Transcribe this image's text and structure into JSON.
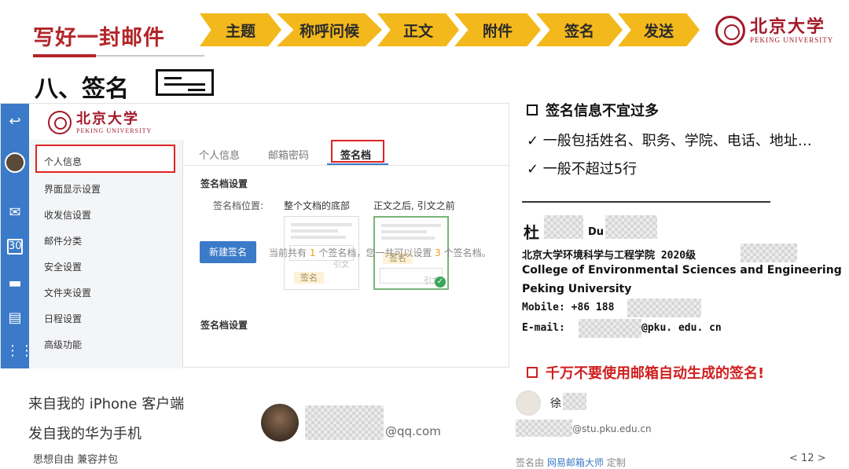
{
  "header": {
    "title": "写好一封邮件",
    "steps": [
      "主题",
      "称呼问候",
      "正文",
      "附件",
      "签名",
      "发送"
    ],
    "logo": {
      "cn": "北京大学",
      "en": "PEKING UNIVERSITY"
    }
  },
  "section": {
    "title": "八、签名"
  },
  "mail_client": {
    "logo": {
      "cn": "北京大学",
      "en": "PEKING UNIVERSITY"
    },
    "sidebar": [
      "个人信息",
      "界面显示设置",
      "收发信设置",
      "邮件分类",
      "安全设置",
      "文件夹设置",
      "日程设置",
      "高级功能"
    ],
    "rail_calendar_day": "30",
    "tabs": [
      "个人信息",
      "邮箱密码",
      "签名档"
    ],
    "settings_heading": "签名档设置",
    "position_label": "签名档位置:",
    "option_bottom": "整个文档的底部",
    "option_after_body": "正文之后, 引文之前",
    "mini_quote": "引文",
    "mini_sig": "签名",
    "list_heading": "签名档设置",
    "new_button": "新建签名",
    "count_prefix": "当前共有",
    "count_current": "1",
    "count_middle": "个签名档，您一共可以设置",
    "count_max": "3",
    "count_suffix": "个签名档。"
  },
  "bottom_left": {
    "line1": "来自我的 iPhone 客户端",
    "line2": "发自我的华为手机",
    "motto": "思想自由 兼容并包",
    "email_suffix": "@qq.com"
  },
  "right": {
    "tip1": "签名信息不宜过多",
    "check1": "✓ 一般包括姓名、职务、学院、电话、地址…",
    "check2": "✓ 一般不超过5行",
    "sig": {
      "name": "杜",
      "name_en": "Du",
      "school_cn": "北京大学环境科学与工程学院 2020级",
      "school_en": "College of Environmental Sciences and Engineering",
      "uni_en": "Peking University",
      "mobile": "Mobile: +86 188",
      "email_label": "E-mail:",
      "email_suffix": "@pku. edu. cn"
    },
    "tip2": "千万不要使用邮箱自动生成的签名!",
    "auto": {
      "name": "徐",
      "email_suffix": "@stu.pku.edu.cn",
      "footer_prefix": "签名由",
      "footer_link": "网易邮箱大师",
      "footer_suffix": "定制"
    },
    "page": "< 12 >"
  },
  "colors": {
    "accent_red": "#b3262a",
    "step_yellow": "#f3b81c",
    "mail_blue": "#3a7ac8",
    "alert_red": "#d11f1f"
  }
}
